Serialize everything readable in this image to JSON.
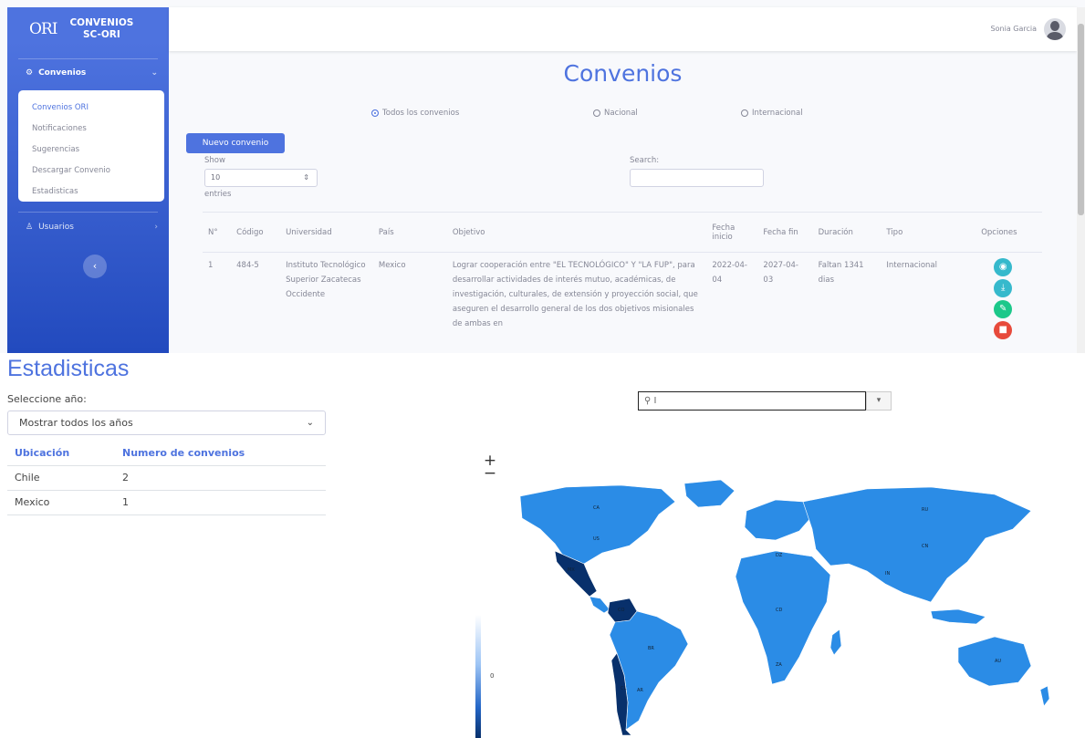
{
  "app": {
    "brand_logo": "ORI",
    "brand_line1": "CONVENIOS",
    "brand_line2": "SC-ORI",
    "menu_convenios": "Convenios",
    "submenu": [
      "Convenios ORI",
      "Notificaciones",
      "Sugerencias",
      "Descargar Convenio",
      "Estadisticas"
    ],
    "menu_usuarios": "Usuarios",
    "user_name": "Sonia Garcia",
    "page_title": "Convenios",
    "filters": [
      "Todos los convenios",
      "Nacional",
      "Internacional"
    ],
    "new_button": "Nuevo convenio",
    "show_label": "Show",
    "show_value": "10",
    "entries_label": "entries",
    "search_label": "Search:",
    "columns": [
      "N°",
      "Código",
      "Universidad",
      "País",
      "Objetivo",
      "Fecha inicio",
      "Fecha fin",
      "Duración",
      "Tipo",
      "Opciones"
    ],
    "rows": [
      {
        "n": "1",
        "codigo": "484-5",
        "universidad": "Instituto Tecnológico Superior Zacatecas Occidente",
        "pais": "Mexico",
        "objetivo": "Lograr cooperación entre \"EL TECNOLÓGICO\" Y \"LA FUP\", para desarrollar actividades de interés mutuo, académicas, de investigación, culturales, de extensión y proyección social, que aseguren el desarrollo general de los dos objetivos misionales de ambas en",
        "fecha_inicio": "2022-04-04",
        "fecha_fin": "2027-04-03",
        "duracion": "Faltan 1341 dias",
        "tipo": "Internacional"
      }
    ],
    "colors": {
      "primary": "#4e73df",
      "info": "#36b9cc",
      "success": "#1cc88a",
      "danger": "#e74a3b"
    }
  },
  "stats": {
    "title": "Estadisticas",
    "year_label": "Seleccione año:",
    "year_select": "Mostrar todos los años",
    "columns": [
      "Ubicación",
      "Numero de convenios"
    ],
    "rows": [
      {
        "ubicacion": "Chile",
        "numero": "2"
      },
      {
        "ubicacion": "Mexico",
        "numero": "1"
      }
    ],
    "map_search_value": "I",
    "legend_tick": "0",
    "zoom_in": "+",
    "zoom_out": "−",
    "map_colors": {
      "base": "#2b8ce6",
      "highlight": "#08306b"
    }
  }
}
